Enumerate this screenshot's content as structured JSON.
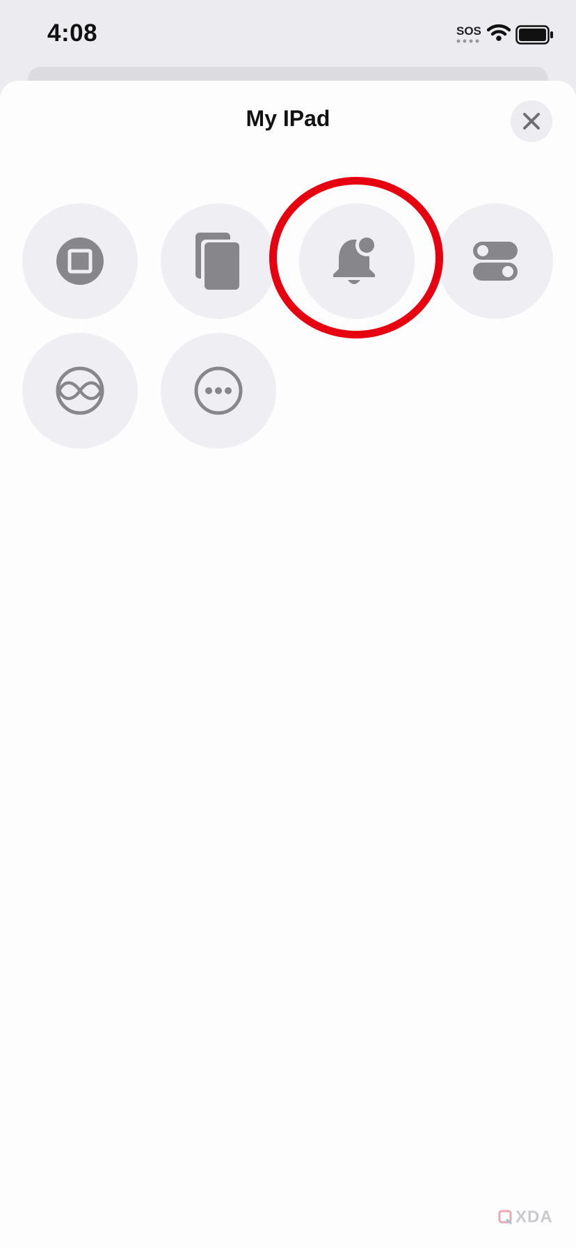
{
  "status_bar": {
    "time": "4:08",
    "carrier": "SOS"
  },
  "sheet": {
    "title": "My IPad",
    "close_icon": "close-icon"
  },
  "actions": [
    {
      "icon": "stop-icon"
    },
    {
      "icon": "copy-icon"
    },
    {
      "icon": "notification-bell-icon",
      "highlighted": true
    },
    {
      "icon": "toggle-switches-icon"
    },
    {
      "icon": "infinity-sphere-icon"
    },
    {
      "icon": "more-icon"
    }
  ],
  "highlight_color": "#e60010",
  "watermark": {
    "text": "XDA"
  }
}
